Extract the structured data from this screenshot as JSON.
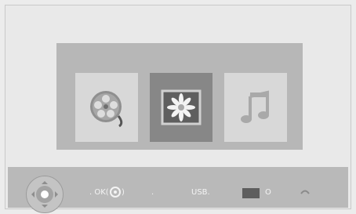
{
  "menu": {
    "items": [
      {
        "name": "video",
        "selected": false,
        "icon": "film-reel-icon"
      },
      {
        "name": "photo",
        "selected": true,
        "icon": "photo-icon"
      },
      {
        "name": "music",
        "selected": false,
        "icon": "music-note-icon"
      }
    ]
  },
  "bottom_bar": {
    "ok_prefix": ". OK(",
    "ok_suffix": ")",
    "separator": ".",
    "usb_label": "USB.",
    "stop_label": "O"
  },
  "colors": {
    "background": "#ececec",
    "panel": "#b7b7b7",
    "tile": "#d8d8d8",
    "selected_tile": "#878787",
    "bottom_bar": "#b9b9b9"
  }
}
